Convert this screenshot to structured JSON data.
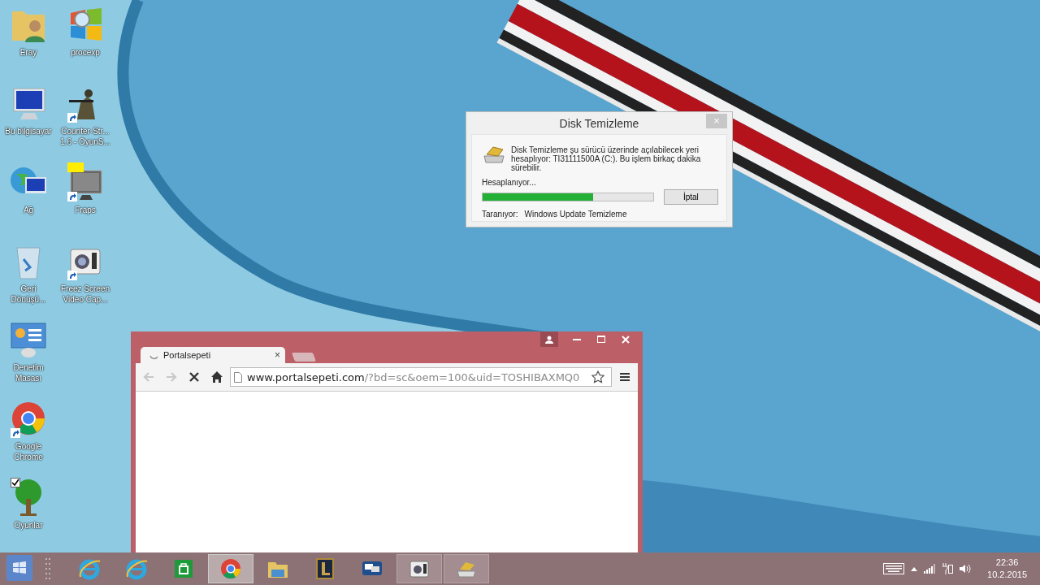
{
  "desktop": {
    "columns": [
      {
        "icons": [
          {
            "kind": "user-folder",
            "lines": [
              "Eray"
            ],
            "shortcut": false,
            "checked": false
          },
          {
            "kind": "computer",
            "lines": [
              "Bu bilgisayar"
            ],
            "shortcut": false,
            "checked": false
          },
          {
            "kind": "network",
            "lines": [
              "Ağ"
            ],
            "shortcut": false,
            "checked": false
          },
          {
            "kind": "recycle",
            "lines": [
              "Geri",
              "Dönüşü..."
            ],
            "shortcut": false,
            "checked": false
          },
          {
            "kind": "control-panel",
            "lines": [
              "Denetim",
              "Masası"
            ],
            "shortcut": false,
            "checked": false
          },
          {
            "kind": "chrome",
            "lines": [
              "Google",
              "Chrome"
            ],
            "shortcut": true,
            "checked": false
          },
          {
            "kind": "tree",
            "lines": [
              "Oyunlar"
            ],
            "shortcut": false,
            "checked": true
          }
        ]
      },
      {
        "icons": [
          {
            "kind": "windows-magnifier",
            "lines": [
              "procexp"
            ],
            "shortcut": false,
            "checked": false
          },
          {
            "kind": "soldier",
            "lines": [
              "Counter-Str...",
              "1.6 - OyunS..."
            ],
            "shortcut": true,
            "checked": false
          },
          {
            "kind": "monitor-99",
            "lines": [
              "Fraps"
            ],
            "shortcut": true,
            "checked": false
          },
          {
            "kind": "camera",
            "lines": [
              "Freez Screen",
              "Video Cap..."
            ],
            "shortcut": true,
            "checked": false
          }
        ]
      }
    ]
  },
  "dialog": {
    "title": "Disk Temizleme",
    "close": "×",
    "message": "Disk Temizleme şu sürücü üzerinde açılabilecek yeri hesaplıyor: TI31111500A (C:). Bu işlem birkaç dakika sürebilir.",
    "status": "Hesaplanıyor...",
    "progress": {
      "level": 0.65
    },
    "cancel_button": "İptal",
    "scanning_label": "Taranıyor:",
    "scanning_item": "Windows Update Temizleme"
  },
  "browser": {
    "tabs": [
      {
        "title": "Portalsepeti",
        "close": "×",
        "loading": true,
        "selected": true
      }
    ],
    "url_host": "www.portalsepeti.com",
    "url_rest": "/?bd=sc&oem=100&uid=TOSHIBAXMQ0",
    "back_disabled": true,
    "forward_disabled": true,
    "loading": true
  },
  "taskbar": {
    "items": [
      {
        "kind": "ie",
        "selected": false,
        "running": false
      },
      {
        "kind": "ie",
        "selected": false,
        "running": false
      },
      {
        "kind": "store",
        "selected": false,
        "running": false
      },
      {
        "kind": "chrome",
        "selected": true,
        "running": true
      },
      {
        "kind": "explorer",
        "selected": false,
        "running": false
      },
      {
        "kind": "lol",
        "selected": false,
        "running": false
      },
      {
        "kind": "chat",
        "selected": false,
        "running": false
      },
      {
        "kind": "camera",
        "selected": false,
        "running": true
      },
      {
        "kind": "disk-cleanup",
        "selected": false,
        "running": true
      }
    ],
    "time": "22:36",
    "date": "10.2.2015"
  }
}
